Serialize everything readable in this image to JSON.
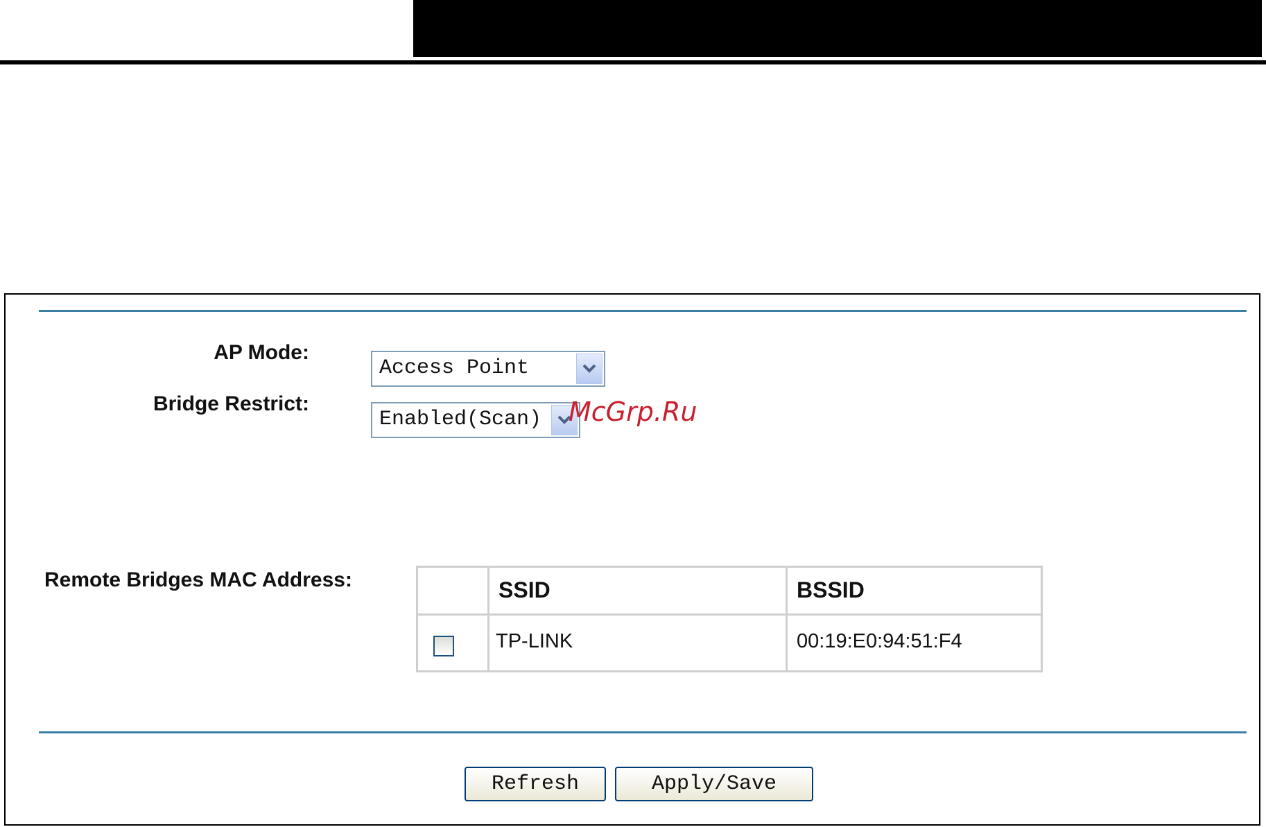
{
  "form": {
    "ap_mode_label": "AP Mode:",
    "ap_mode_value": "Access Point",
    "bridge_restrict_label": "Bridge Restrict:",
    "bridge_restrict_value": "Enabled(Scan)",
    "remote_bridges_label": "Remote Bridges MAC Address:"
  },
  "table": {
    "headers": {
      "ssid": "SSID",
      "bssid": "BSSID"
    },
    "rows": [
      {
        "checked": false,
        "ssid": "TP-LINK",
        "bssid": "00:19:E0:94:51:F4"
      }
    ]
  },
  "buttons": {
    "refresh": "Refresh",
    "apply_save": "Apply/Save"
  },
  "watermark": "McGrp.Ru",
  "icons": {
    "dropdown": "chevron-down-icon"
  },
  "colors": {
    "rule_blue": "#3c7fa6",
    "select_border": "#7f9db9",
    "watermark_red": "#c9202f"
  }
}
